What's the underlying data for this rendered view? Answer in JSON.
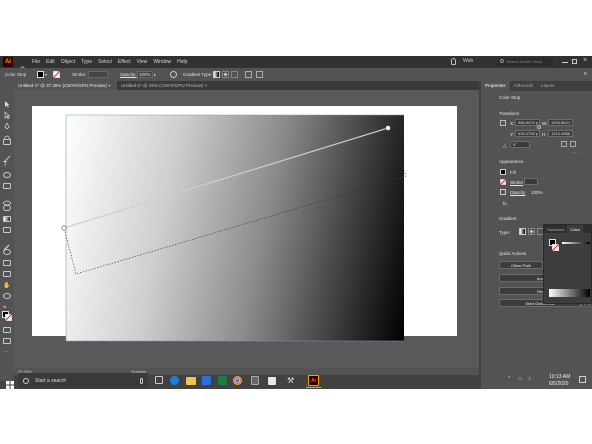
{
  "menubar": {
    "logo": "Ai",
    "items": [
      "File",
      "Edit",
      "Object",
      "Type",
      "Select",
      "Effect",
      "View",
      "Window",
      "Help"
    ],
    "workspace": "Web",
    "search_placeholder": "Search Adobe Stock"
  },
  "control": {
    "color_stop_label": "Color Stop",
    "stroke_label": "Stroke:",
    "opacity_label": "Opacity:",
    "opacity_value": "100%",
    "gradient_type_label": "Gradient Type:"
  },
  "tabs": [
    {
      "label": "Untitled-1* @ 37.28% (CMYK/GPU Preview)",
      "active": true
    },
    {
      "label": "Untitled-2* @ 25% (CMYK/GPU Preview)",
      "active": false
    }
  ],
  "status": {
    "zoom": "37.28%",
    "tool": "Gradient"
  },
  "panel": {
    "tabs": [
      "Properties",
      "Artboards",
      "Layers"
    ],
    "color_stop": "Color Stop",
    "transform": "Transform",
    "x": "966.5479 p",
    "y": "535.4795 p",
    "w": "1495.8604",
    "h": "1513.4988",
    "angle": "0°",
    "appearance": "Appearance",
    "fill": "Fill",
    "stroke": "Stroke",
    "opacity": "Opacity",
    "opacity_value": "100%",
    "fx": "fx.",
    "gradient": "Gradient",
    "type_label": "Type:",
    "quick_actions": "Quick Actions",
    "offset_path": "Offset Path",
    "expand_shape": "Expand Shape",
    "arrange": "Arrange",
    "recolor": "Recolor",
    "start_global_edit": "Start Global Edit"
  },
  "color_popup": {
    "tabs": [
      "Swatches",
      "Color"
    ]
  },
  "taskbar": {
    "search": "Start a search",
    "time": "10:13 AM",
    "date": "6/5/2020"
  },
  "colors": {
    "accent": "#ff9a00",
    "ai_bg": "#330000",
    "ui_dark": "#424242",
    "ui_mid": "#535353"
  }
}
